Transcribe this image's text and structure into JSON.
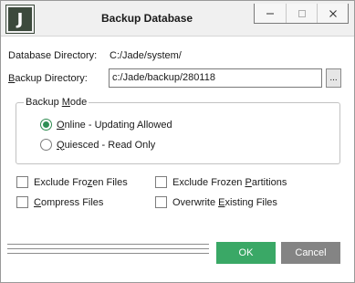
{
  "window": {
    "title": "Backup Database",
    "logo_letter": "J"
  },
  "titlebar_controls": {
    "icons": [
      "minimize-icon",
      "maximize-icon",
      "close-icon"
    ]
  },
  "database_directory": {
    "label": "Database Directory:",
    "value": "C:/Jade/system/"
  },
  "backup_directory": {
    "label_prefix": "",
    "label_mnemonic": "B",
    "label_rest": "ackup Directory:",
    "value": "c:/Jade/backup/280118",
    "browse_label": "..."
  },
  "backup_mode": {
    "title_pre": "Backup ",
    "title_mnemonic": "M",
    "title_rest": "ode",
    "options": [
      {
        "mnemonic": "O",
        "rest": "nline - Updating Allowed",
        "checked": true
      },
      {
        "mnemonic": "Q",
        "rest": "uiesced  -  Read Only",
        "checked": false
      }
    ]
  },
  "options": {
    "exclude_frozen_files": {
      "pre": "Exclude Fro",
      "mnemonic": "z",
      "rest": "en Files",
      "checked": false
    },
    "exclude_frozen_partitions": {
      "pre": "Exclude Frozen ",
      "mnemonic": "P",
      "rest": "artitions",
      "checked": false
    },
    "compress_files": {
      "pre": "",
      "mnemonic": "C",
      "rest": "ompress Files",
      "checked": false
    },
    "overwrite_existing_files": {
      "pre": "Overwrite ",
      "mnemonic": "E",
      "rest": "xisting Files",
      "checked": false
    }
  },
  "buttons": {
    "ok": "OK",
    "cancel": "Cancel"
  },
  "colors": {
    "accent_green": "#3aa866",
    "cancel_gray": "#848484",
    "radio_green": "#2f8f55"
  }
}
